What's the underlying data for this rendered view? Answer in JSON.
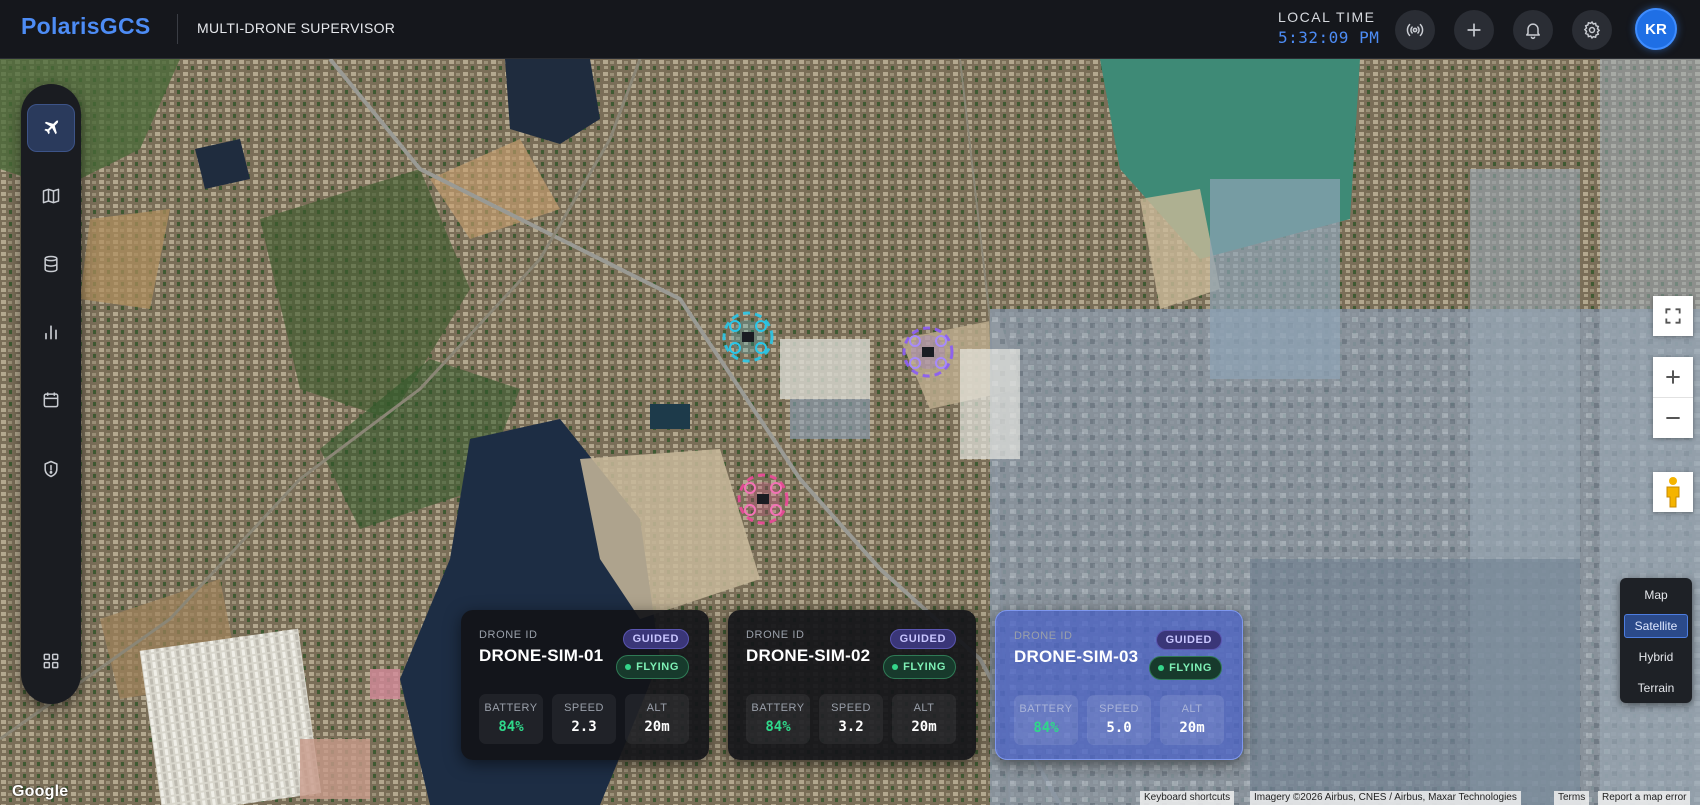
{
  "header": {
    "brand": "PolarisGCS",
    "subtitle": "MULTI-DRONE SUPERVISOR",
    "time_label": "LOCAL TIME",
    "time_value": "5:32:09 PM",
    "actions": [
      {
        "icon": "broadcast-icon"
      },
      {
        "icon": "plus-icon"
      },
      {
        "icon": "bell-icon"
      },
      {
        "icon": "gear-icon"
      }
    ],
    "avatar_initials": "KR"
  },
  "sidebar": {
    "items": [
      {
        "icon": "airplane-icon",
        "active": true
      },
      {
        "icon": "map-icon",
        "active": false
      },
      {
        "icon": "database-icon",
        "active": false
      },
      {
        "icon": "bar-chart-icon",
        "active": false
      },
      {
        "icon": "calendar-icon",
        "active": false
      },
      {
        "icon": "shield-icon",
        "active": false
      },
      {
        "icon": "grid-icon",
        "active": false
      }
    ]
  },
  "map_controls": {
    "map_types": [
      "Map",
      "Satellite",
      "Hybrid",
      "Terrain"
    ],
    "selected_map_type": "Satellite"
  },
  "drone_markers": [
    {
      "color": "#29c6e8"
    },
    {
      "color": "#8b5cf6"
    },
    {
      "color": "#ec4899"
    }
  ],
  "cards": [
    {
      "label": "DRONE ID",
      "id": "DRONE-SIM-01",
      "mode": "GUIDED",
      "status": "FLYING",
      "battery_label": "BATTERY",
      "battery": "84%",
      "speed_label": "SPEED",
      "speed": "2.3",
      "alt_label": "ALT",
      "alt": "20m",
      "selected": false
    },
    {
      "label": "DRONE ID",
      "id": "DRONE-SIM-02",
      "mode": "GUIDED",
      "status": "FLYING",
      "battery_label": "BATTERY",
      "battery": "84%",
      "speed_label": "SPEED",
      "speed": "3.2",
      "alt_label": "ALT",
      "alt": "20m",
      "selected": false
    },
    {
      "label": "DRONE ID",
      "id": "DRONE-SIM-03",
      "mode": "GUIDED",
      "status": "FLYING",
      "battery_label": "BATTERY",
      "battery": "84%",
      "speed_label": "SPEED",
      "speed": "5.0",
      "alt_label": "ALT",
      "alt": "20m",
      "selected": true
    }
  ],
  "attribution": {
    "logo": "Google",
    "keyboard": "Keyboard shortcuts",
    "imagery": "Imagery ©2026 Airbus, CNES / Airbus, Maxar Technologies",
    "terms": "Terms",
    "report": "Report a map error"
  },
  "colors": {
    "accent": "#4d8cf5",
    "battery_green": "#2fd88a",
    "card_selected": "#4a62c9"
  }
}
